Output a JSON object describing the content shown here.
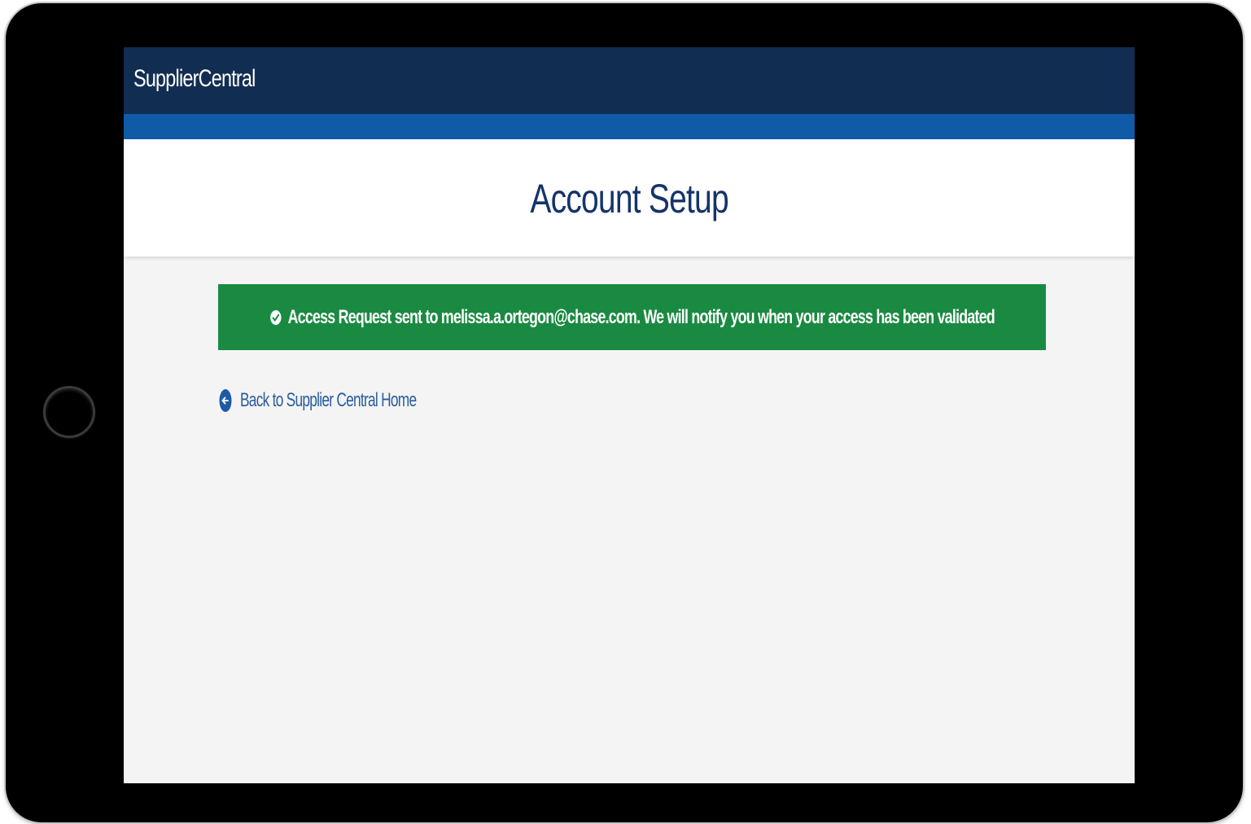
{
  "app": {
    "brand": "SupplierCentral"
  },
  "page": {
    "title": "Account Setup"
  },
  "alert": {
    "icon": "check-circle-icon",
    "message": "Access Request sent to melissa.a.ortegon@chase.com. We will notify you when your access has been validated",
    "color": "#1a8a42"
  },
  "nav": {
    "back_icon": "arrow-left-circle-icon",
    "back_label": "Back to Supplier Central Home"
  },
  "colors": {
    "header": "#122d52",
    "accent": "#0f5ba8",
    "title": "#16336b",
    "link": "#2a5d9f"
  }
}
